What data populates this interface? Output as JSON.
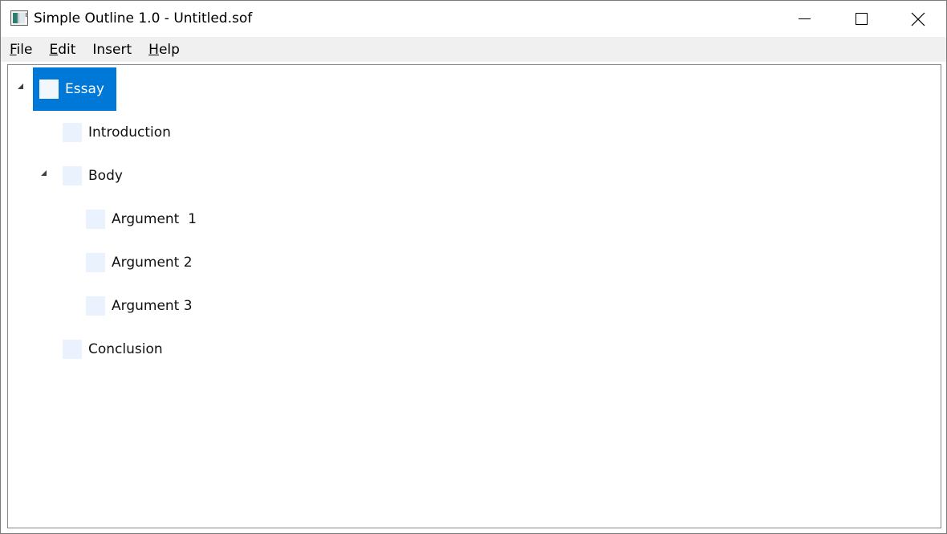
{
  "window": {
    "title": "Simple Outline 1.0 - Untitled.sof",
    "app_icon": "app-window-icon",
    "controls": {
      "minimize": "minimize-icon",
      "maximize": "maximize-icon",
      "close": "close-icon"
    }
  },
  "menu": {
    "items": [
      {
        "accel": "F",
        "rest": "ile"
      },
      {
        "accel": "E",
        "rest": "dit"
      },
      {
        "accel": "",
        "rest": "Insert"
      },
      {
        "accel": "H",
        "rest": "elp"
      }
    ]
  },
  "outline": {
    "root": {
      "label": "Essay",
      "expanded": true,
      "selected": true
    },
    "nodes": [
      {
        "label": "Introduction"
      },
      {
        "label": "Body",
        "expanded": true
      },
      {
        "label": "Argument  1"
      },
      {
        "label": "Argument 2"
      },
      {
        "label": "Argument 3"
      },
      {
        "label": "Conclusion"
      }
    ]
  },
  "colors": {
    "selection": "#0078d7",
    "node_box": "#eaf3fd",
    "menubar": "#f0f0f0"
  }
}
